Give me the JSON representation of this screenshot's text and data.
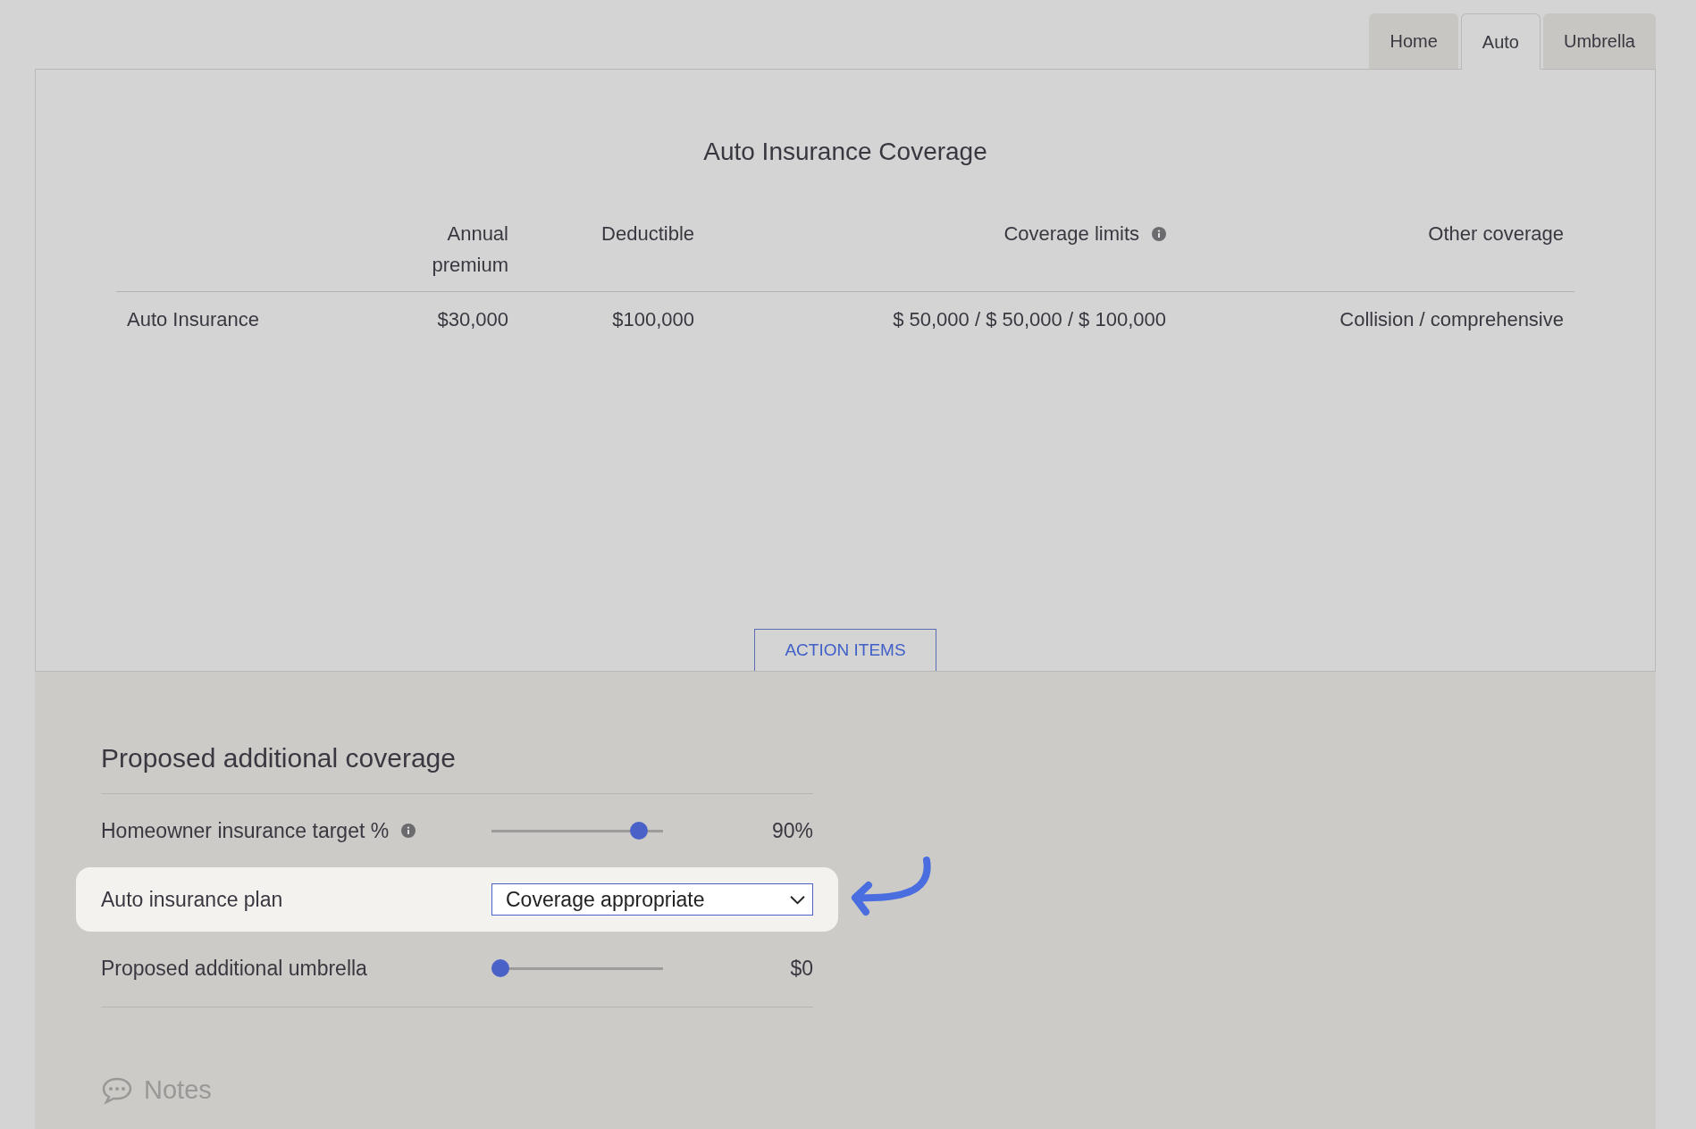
{
  "tabs": [
    {
      "label": "Home",
      "selected": false
    },
    {
      "label": "Auto",
      "selected": true
    },
    {
      "label": "Umbrella",
      "selected": false
    }
  ],
  "coverage": {
    "title": "Auto Insurance Coverage",
    "columns": [
      {
        "info": false
      },
      {
        "label": "Annual premium",
        "info": false
      },
      {
        "label": "Deductible",
        "info": false
      },
      {
        "label": "Coverage limits",
        "info": true
      },
      {
        "label": "Other coverage",
        "info": false
      }
    ],
    "rows": [
      {
        "cells": [
          "Auto Insurance",
          "$30,000",
          "$100,000",
          "$ 50,000 / $ 50,000 / $ 100,000",
          "Collision / comprehensive"
        ]
      }
    ],
    "action_button": "ACTION ITEMS"
  },
  "proposed": {
    "heading": "Proposed additional coverage",
    "rows": [
      {
        "kind": "slider",
        "label": "Homeowner insurance target %",
        "info": true,
        "level": 0.9,
        "value": "90%",
        "highlighted": false
      },
      {
        "kind": "select",
        "label": "Auto insurance plan",
        "info": false,
        "value": "Coverage appropriate",
        "highlighted": true
      },
      {
        "kind": "slider",
        "label": "Proposed additional umbrella",
        "info": false,
        "level": 0,
        "value": "$0",
        "highlighted": false
      }
    ]
  },
  "notes": {
    "label": "Notes"
  }
}
